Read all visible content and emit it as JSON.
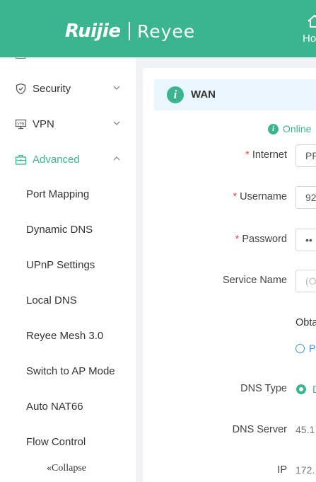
{
  "header": {
    "brand_primary": "Ruijie",
    "brand_secondary": "Reyee",
    "nav_home_label": "Ho",
    "colors": {
      "brand_green": "#3bb58e",
      "required_red": "#e84a4a",
      "link_blue": "#3b8fd9"
    }
  },
  "sidebar": {
    "menus": [
      {
        "label": "Security",
        "icon": "shield-icon",
        "expanded": false
      },
      {
        "label": "VPN",
        "icon": "vpn-icon",
        "expanded": false
      },
      {
        "label": "Advanced",
        "icon": "toolbox-icon",
        "expanded": true
      }
    ],
    "submenu": [
      "Port Mapping",
      "Dynamic DNS",
      "UPnP Settings",
      "Local DNS",
      "Reyee Mesh 3.0",
      "Switch to AP Mode",
      "Auto NAT66",
      "Flow Control"
    ],
    "collapse_label": "Collapse"
  },
  "wan": {
    "section_title": "WAN",
    "status": "Online",
    "fields": {
      "internet": {
        "label": "Internet",
        "value": "PP",
        "required": true
      },
      "username": {
        "label": "Username",
        "value": "92",
        "required": true
      },
      "password": {
        "label": "Password",
        "value": "••",
        "required": true
      },
      "service_name": {
        "label": "Service Name",
        "placeholder": "(O",
        "required": false
      }
    },
    "obtain_text": "Obta",
    "link_text": "Pl",
    "dns_type": {
      "label": "DNS Type",
      "option": "D"
    },
    "dns_server": {
      "label": "DNS Server",
      "value": "45.1"
    },
    "ip": {
      "label": "IP",
      "value": "172."
    }
  }
}
